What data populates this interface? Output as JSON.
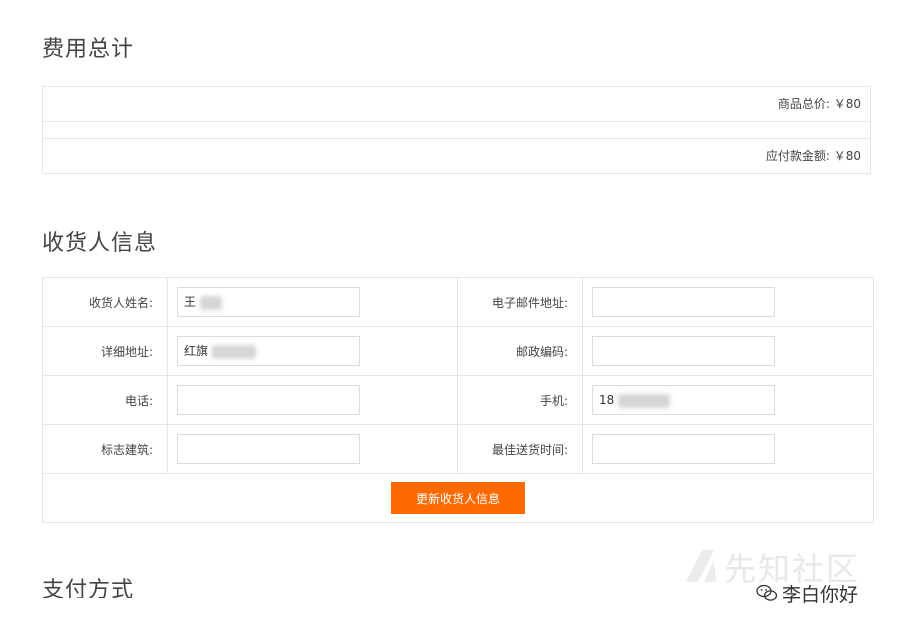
{
  "fee_summary": {
    "title": "费用总计",
    "goods_total": "商品总价: ￥80",
    "amount_payable": "应付款金额: ￥80"
  },
  "receiver": {
    "title": "收货人信息",
    "name_label": "收货人姓名:",
    "name_value": "王",
    "email_label": "电子邮件地址:",
    "email_value": "",
    "address_label": "详细地址:",
    "address_value": "红旗",
    "zipcode_label": "邮政编码:",
    "zipcode_value": "",
    "phone_label": "电话:",
    "phone_value": "",
    "mobile_label": "手机:",
    "mobile_value": "18",
    "landmark_label": "标志建筑:",
    "landmark_value": "",
    "delivery_time_label": "最佳送货时间:",
    "delivery_time_value": "",
    "update_button": "更新收货人信息"
  },
  "payment": {
    "title": "支付方式"
  },
  "watermark": {
    "site": "先知社区",
    "account": "李白你好"
  },
  "colors": {
    "accent": "#ff6a00",
    "border": "#e6e6e6"
  }
}
